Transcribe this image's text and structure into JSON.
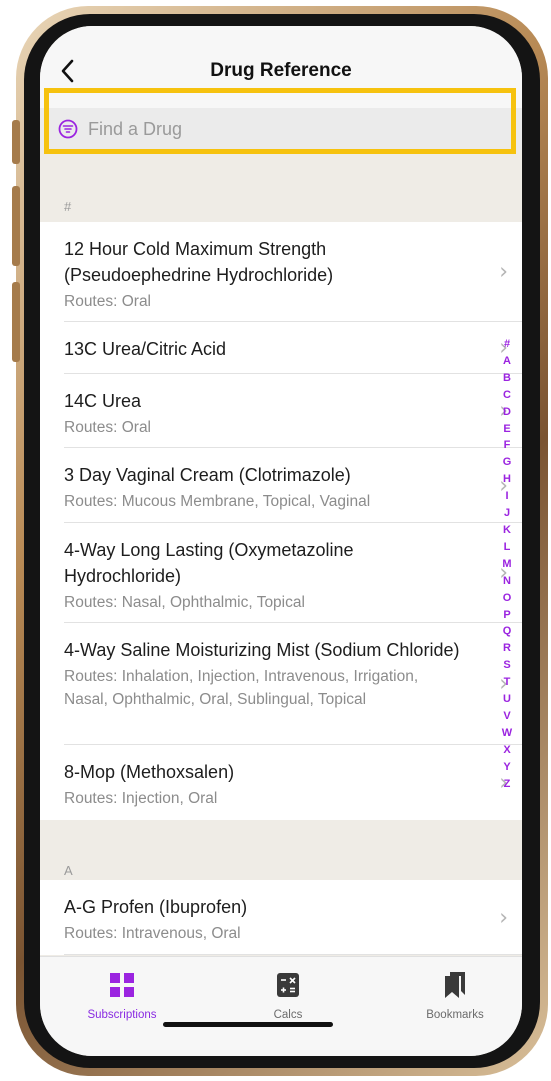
{
  "nav": {
    "title": "Drug Reference",
    "back_icon": "chevron-left-icon"
  },
  "search": {
    "placeholder": "Find a Drug",
    "icon": "filter-icon",
    "accent": "#9b24e0"
  },
  "sections": [
    {
      "header": "#",
      "items": [
        {
          "name": "12 Hour Cold Maximum Strength (Pseudoephedrine Hydrochloride)",
          "routes": "Routes: Oral"
        },
        {
          "name": "13C Urea/Citric Acid",
          "routes": ""
        },
        {
          "name": "14C Urea",
          "routes": "Routes: Oral"
        },
        {
          "name": "3 Day Vaginal Cream (Clotrimazole)",
          "routes": "Routes: Mucous Membrane, Topical, Vaginal"
        },
        {
          "name": "4-Way Long Lasting (Oxymetazoline Hydrochloride)",
          "routes": "Routes: Nasal, Ophthalmic, Topical"
        },
        {
          "name": "4-Way Saline Moisturizing Mist (Sodium Chloride)",
          "routes": "Routes: Inhalation, Injection, Intravenous, Irrigation, Nasal, Ophthalmic, Oral, Sublingual, Topical"
        },
        {
          "name": "8-Mop (Methoxsalen)",
          "routes": "Routes: Injection, Oral"
        }
      ]
    },
    {
      "header": "A",
      "items": [
        {
          "name": "A-G Profen (Ibuprofen)",
          "routes": "Routes: Intravenous, Oral"
        }
      ]
    }
  ],
  "index_letters": [
    "#",
    "A",
    "B",
    "C",
    "D",
    "E",
    "F",
    "G",
    "H",
    "I",
    "J",
    "K",
    "L",
    "M",
    "N",
    "O",
    "P",
    "Q",
    "R",
    "S",
    "T",
    "U",
    "V",
    "W",
    "X",
    "Y",
    "Z"
  ],
  "tabs": [
    {
      "label": "Subscriptions",
      "icon": "grid-icon",
      "active": true
    },
    {
      "label": "Calcs",
      "icon": "calculator-icon",
      "active": false
    },
    {
      "label": "Bookmarks",
      "icon": "bookmarks-icon",
      "active": false
    }
  ],
  "colors": {
    "accent": "#9b24e0",
    "highlight_border": "#f6c20e"
  }
}
